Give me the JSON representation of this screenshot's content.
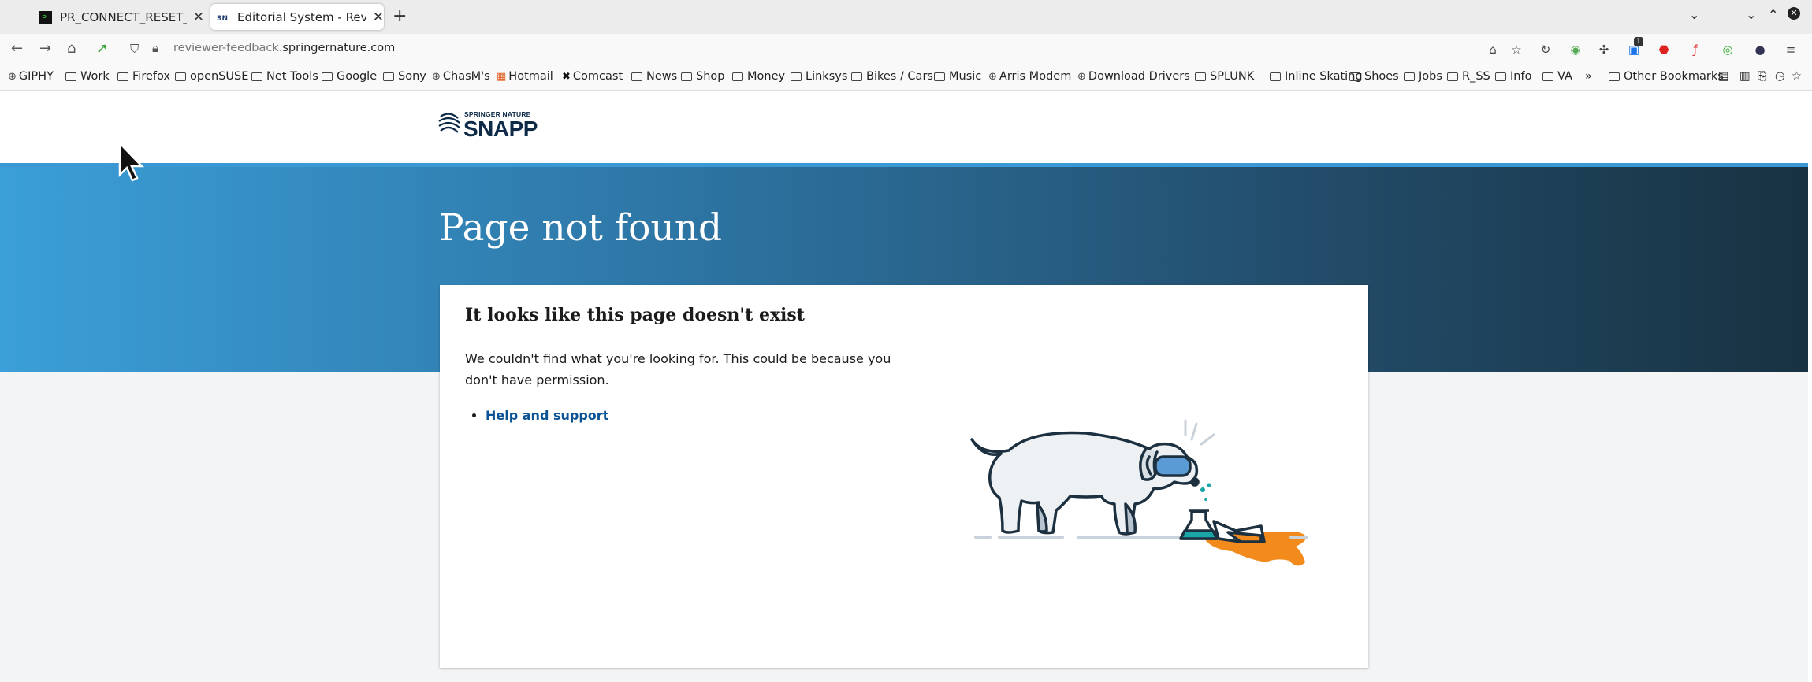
{
  "browser": {
    "tabs": [
      {
        "title": "PR_CONNECT_RESET_ERROR",
        "active": false
      },
      {
        "title": "Editorial System - Reviewer",
        "active": true
      }
    ],
    "url_prefix": "reviewer-feedback.",
    "url_host": "springernature.com",
    "notification_count": "1",
    "bookmarks": [
      {
        "label": "GIPHY",
        "icon": "globe-icon"
      },
      {
        "label": "Work",
        "icon": "folder-icon"
      },
      {
        "label": "Firefox",
        "icon": "folder-icon"
      },
      {
        "label": "openSUSE",
        "icon": "folder-icon"
      },
      {
        "label": "Net Tools",
        "icon": "folder-icon"
      },
      {
        "label": "Google",
        "icon": "folder-icon"
      },
      {
        "label": "Sony",
        "icon": "folder-icon"
      },
      {
        "label": "ChasM's",
        "icon": "globe-icon"
      },
      {
        "label": "Hotmail",
        "icon": "microsoft-icon"
      },
      {
        "label": "Comcast",
        "icon": "x-icon"
      },
      {
        "label": "News",
        "icon": "folder-icon"
      },
      {
        "label": "Shop",
        "icon": "folder-icon"
      },
      {
        "label": "Money",
        "icon": "folder-icon"
      },
      {
        "label": "Linksys",
        "icon": "folder-icon"
      },
      {
        "label": "Bikes / Cars",
        "icon": "folder-icon"
      },
      {
        "label": "Music",
        "icon": "folder-icon"
      },
      {
        "label": "Arris Modem",
        "icon": "globe-icon"
      },
      {
        "label": "Download Drivers",
        "icon": "globe-icon"
      },
      {
        "label": "SPLUNK",
        "icon": "folder-icon"
      },
      {
        "label": "Inline Skating",
        "icon": "folder-icon"
      },
      {
        "label": "Shoes",
        "icon": "folder-icon"
      },
      {
        "label": "Jobs",
        "icon": "folder-icon"
      },
      {
        "label": "R_SS",
        "icon": "folder-icon"
      },
      {
        "label": "Info",
        "icon": "folder-icon"
      },
      {
        "label": "VA",
        "icon": "folder-icon"
      }
    ],
    "other_bookmarks": "Other Bookmarks"
  },
  "site": {
    "logo_small": "SPRINGER NATURE",
    "logo_big": "SNAPP",
    "page_title": "Page not found",
    "card_title": "It looks like this page doesn't exist",
    "card_body": "We couldn't find what you're looking for. This could be because you don't have permission.",
    "help_link": "Help and support"
  },
  "colors": {
    "hero_start": "#3b9fd8",
    "hero_end": "#183241",
    "link": "#0b5394",
    "brand_navy": "#0e2a47",
    "spill_orange": "#f28a1c",
    "flask_teal": "#1aa6a6"
  }
}
